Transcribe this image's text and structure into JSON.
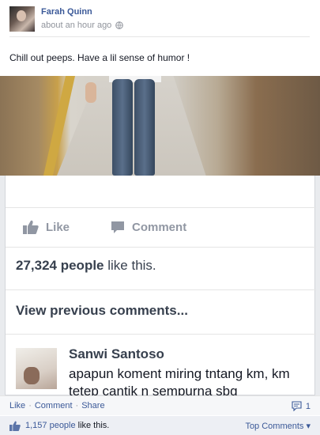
{
  "post": {
    "author": "Farah Quinn",
    "timestamp": "about an hour ago",
    "privacy_icon": "globe-icon",
    "status_text": "Chill out peeps. Have a lil sense of humor !"
  },
  "photo": {
    "like_label": "Like",
    "comment_label": "Comment",
    "likes_count": "27,324 people",
    "likes_suffix": "like this.",
    "view_previous": "View previous comments...",
    "commenter_name": "Sanwi Santoso",
    "comment_text": "apapun koment miring tntang km, km tetep cantik n sempurna sbg"
  },
  "ufi": {
    "like_link": "Like",
    "comment_link": "Comment",
    "share_link": "Share",
    "comment_count": "1",
    "likes_number": "1,157 people",
    "likes_suffix": "like this.",
    "top_comments": "Top Comments ▾"
  },
  "colors": {
    "link_blue": "#3b5998",
    "muted_gray": "#90949c"
  }
}
